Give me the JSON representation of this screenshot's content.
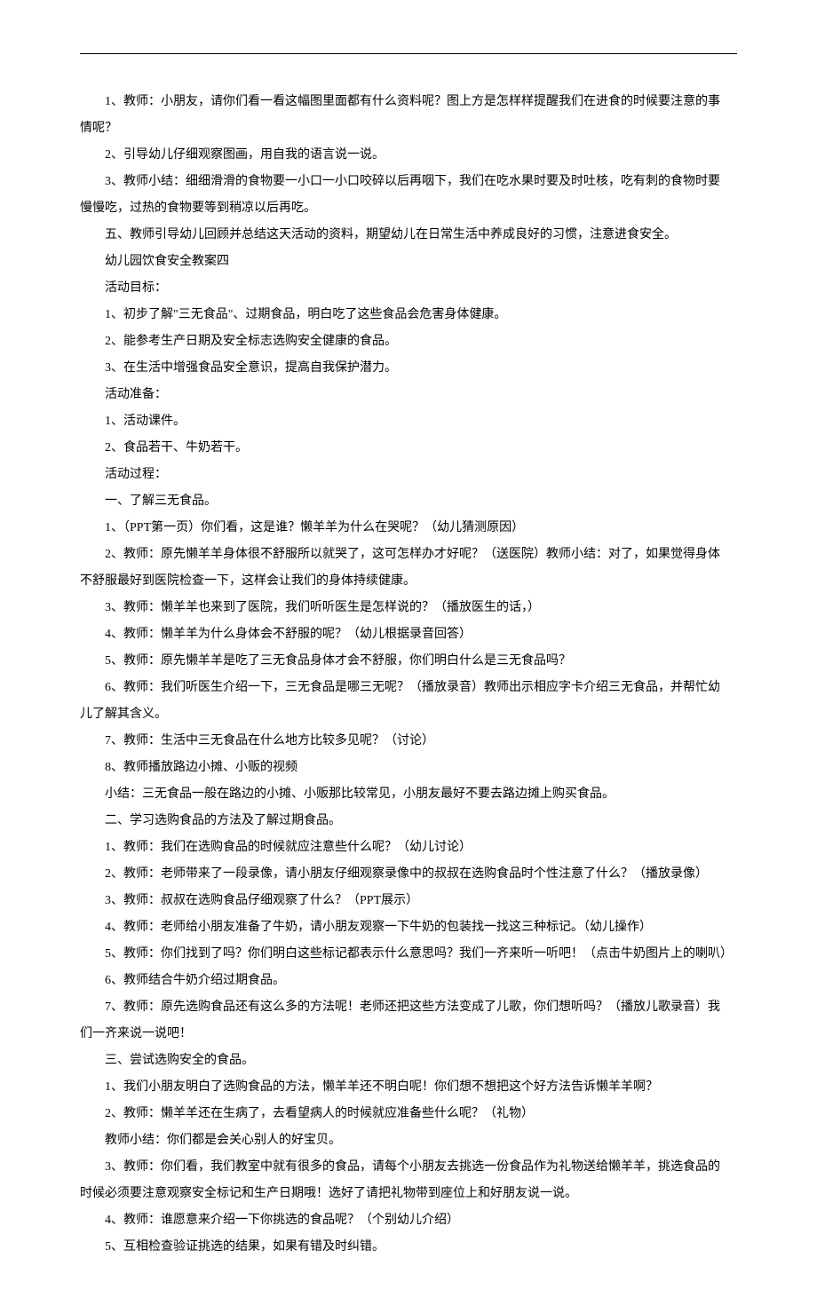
{
  "lines": [
    {
      "indent": true,
      "text": "1、教师：小朋友，请你们看一看这幅图里面都有什么资料呢？图上方是怎样样提醒我们在进食的时候要注意的事"
    },
    {
      "indent": false,
      "text": "情呢？"
    },
    {
      "indent": true,
      "text": "2、引导幼儿仔细观察图画，用自我的语言说一说。"
    },
    {
      "indent": true,
      "text": "3、教师小结：细细滑滑的食物要一小口一小口咬碎以后再咽下，我们在吃水果时要及时吐核，吃有刺的食物时要"
    },
    {
      "indent": false,
      "text": "慢慢吃，过热的食物要等到稍凉以后再吃。"
    },
    {
      "indent": true,
      "text": "五、教师引导幼儿回顾并总结这天活动的资料，期望幼儿在日常生活中养成良好的习惯，注意进食安全。"
    },
    {
      "indent": true,
      "text": "幼儿园饮食安全教案四"
    },
    {
      "indent": true,
      "text": "活动目标："
    },
    {
      "indent": true,
      "text": "1、初步了解\"三无食品\"、过期食品，明白吃了这些食品会危害身体健康。"
    },
    {
      "indent": true,
      "text": "2、能参考生产日期及安全标志选购安全健康的食品。"
    },
    {
      "indent": true,
      "text": "3、在生活中增强食品安全意识，提高自我保护潜力。"
    },
    {
      "indent": true,
      "text": "活动准备："
    },
    {
      "indent": true,
      "text": "1、活动课件。"
    },
    {
      "indent": true,
      "text": "2、食品若干、牛奶若干。"
    },
    {
      "indent": true,
      "text": "活动过程："
    },
    {
      "indent": true,
      "text": "一、了解三无食品。"
    },
    {
      "indent": true,
      "text": "1、（PPT第一页）你们看，这是谁？懒羊羊为什么在哭呢？（幼儿猜测原因）"
    },
    {
      "indent": true,
      "text": "2、教师：原先懒羊羊身体很不舒服所以就哭了，这可怎样办才好呢？（送医院）教师小结：对了，如果觉得身体"
    },
    {
      "indent": false,
      "text": "不舒服最好到医院检查一下，这样会让我们的身体持续健康。"
    },
    {
      "indent": true,
      "text": "3、教师：懒羊羊也来到了医院，我们听听医生是怎样说的？（播放医生的话，）"
    },
    {
      "indent": true,
      "text": "4、教师：懒羊羊为什么身体会不舒服的呢？（幼儿根据录音回答）"
    },
    {
      "indent": true,
      "text": "5、教师：原先懒羊羊是吃了三无食品身体才会不舒服，你们明白什么是三无食品吗？"
    },
    {
      "indent": true,
      "text": "6、教师：我们听医生介绍一下，三无食品是哪三无呢？（播放录音）教师出示相应字卡介绍三无食品，并帮忙幼"
    },
    {
      "indent": false,
      "text": "儿了解其含义。"
    },
    {
      "indent": true,
      "text": "7、教师：生活中三无食品在什么地方比较多见呢？（讨论）"
    },
    {
      "indent": true,
      "text": "8、教师播放路边小摊、小贩的视频"
    },
    {
      "indent": true,
      "text": "小结：三无食品一般在路边的小摊、小贩那比较常见，小朋友最好不要去路边摊上购买食品。"
    },
    {
      "indent": true,
      "text": "二、学习选购食品的方法及了解过期食品。"
    },
    {
      "indent": true,
      "text": "1、教师：我们在选购食品的时候就应注意些什么呢？（幼儿讨论）"
    },
    {
      "indent": true,
      "text": "2、教师：老师带来了一段录像，请小朋友仔细观察录像中的叔叔在选购食品时个性注意了什么？（播放录像）"
    },
    {
      "indent": true,
      "text": "3、教师：叔叔在选购食品仔细观察了什么？（PPT展示）"
    },
    {
      "indent": true,
      "text": "4、教师：老师给小朋友准备了牛奶，请小朋友观察一下牛奶的包装找一找这三种标记。（幼儿操作）"
    },
    {
      "indent": true,
      "text": "5、教师：你们找到了吗？你们明白这些标记都表示什么意思吗？我们一齐来听一听吧！（点击牛奶图片上的喇叭）"
    },
    {
      "indent": true,
      "text": "6、教师结合牛奶介绍过期食品。"
    },
    {
      "indent": true,
      "text": "7、教师：原先选购食品还有这么多的方法呢！老师还把这些方法变成了儿歌，你们想听吗？（播放儿歌录音）我"
    },
    {
      "indent": false,
      "text": "们一齐来说一说吧！"
    },
    {
      "indent": true,
      "text": "三、尝试选购安全的食品。"
    },
    {
      "indent": true,
      "text": "1、我们小朋友明白了选购食品的方法，懒羊羊还不明白呢！你们想不想把这个好方法告诉懒羊羊啊？"
    },
    {
      "indent": true,
      "text": "2、教师：懒羊羊还在生病了，去看望病人的时候就应准备些什么呢？（礼物）"
    },
    {
      "indent": true,
      "text": "教师小结：你们都是会关心别人的好宝贝。"
    },
    {
      "indent": true,
      "text": "3、教师：你们看，我们教室中就有很多的食品，请每个小朋友去挑选一份食品作为礼物送给懒羊羊，挑选食品的"
    },
    {
      "indent": false,
      "text": "时候必须要注意观察安全标记和生产日期哦！选好了请把礼物带到座位上和好朋友说一说。"
    },
    {
      "indent": true,
      "text": "4、教师：谁愿意来介绍一下你挑选的食品呢？（个别幼儿介绍）"
    },
    {
      "indent": true,
      "text": "5、互相检查验证挑选的结果，如果有错及时纠错。"
    }
  ]
}
